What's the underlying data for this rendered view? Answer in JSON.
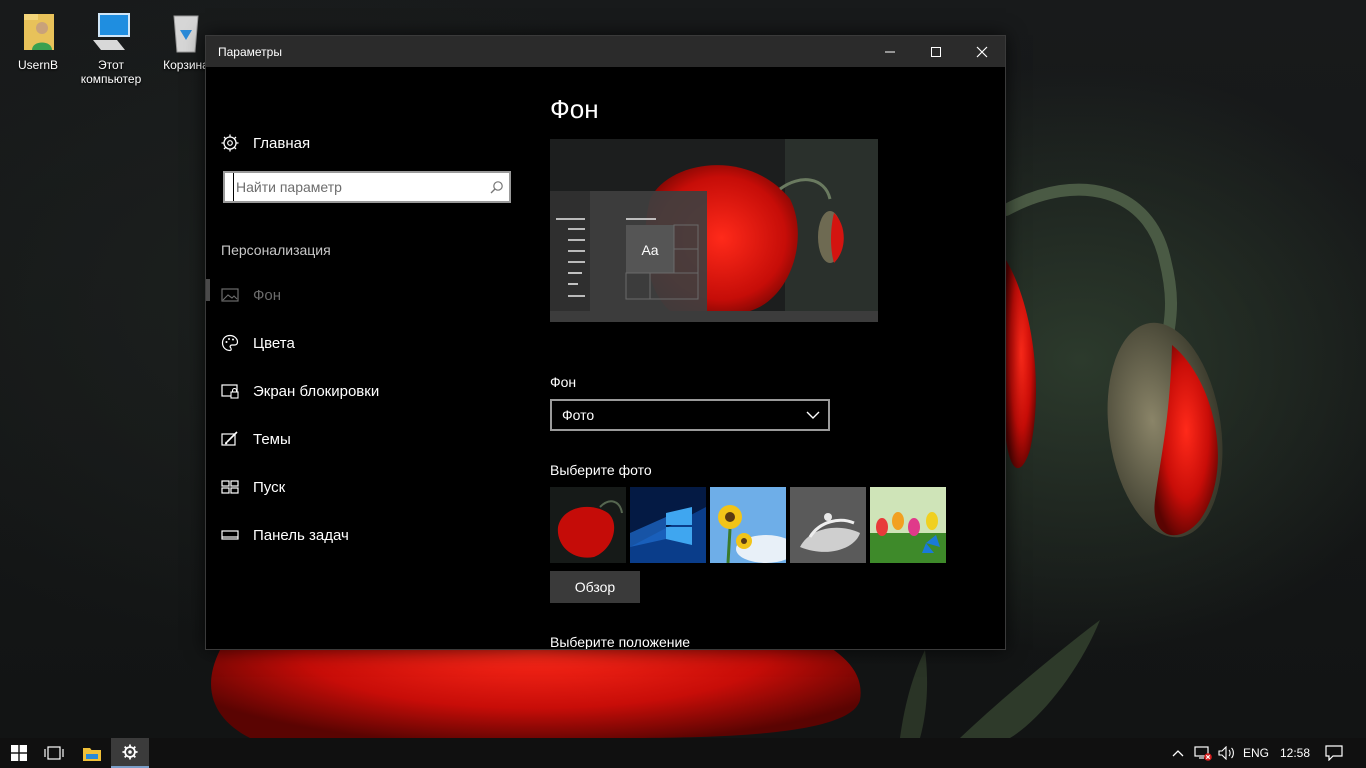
{
  "desktop": {
    "icons": [
      {
        "label": "UsernB"
      },
      {
        "label": "Этот компьютер"
      },
      {
        "label": "Корзина"
      }
    ]
  },
  "window": {
    "title": "Параметры",
    "controls": {
      "minimize": "minimize-icon",
      "maximize": "maximize-icon",
      "close": "close-icon"
    }
  },
  "nav": {
    "home_label": "Главная",
    "search_placeholder": "Найти параметр",
    "section_header": "Персонализация",
    "items": [
      {
        "label": "Фон",
        "icon": "picture-icon",
        "active": true
      },
      {
        "label": "Цвета",
        "icon": "palette-icon",
        "active": false
      },
      {
        "label": "Экран блокировки",
        "icon": "lock-screen-icon",
        "active": false
      },
      {
        "label": "Темы",
        "icon": "themes-icon",
        "active": false
      },
      {
        "label": "Пуск",
        "icon": "start-icon",
        "active": false
      },
      {
        "label": "Панель задач",
        "icon": "taskbar-icon",
        "active": false
      }
    ]
  },
  "content": {
    "title": "Фон",
    "preview_sample_text": "Aa",
    "background_label": "Фон",
    "background_selected": "Фото",
    "choose_photo_label": "Выберите фото",
    "browse_label": "Обзор",
    "choose_position_label": "Выберите положение",
    "thumbnails": [
      "poppy",
      "windows-logo",
      "sunflower",
      "white-flower",
      "tulips-butterfly"
    ]
  },
  "taskbar": {
    "language": "ENG",
    "time": "12:58"
  },
  "colors": {
    "window_bg": "#000000",
    "titlebar": "#2b2b2b",
    "accent_red": "#c4100c",
    "taskbar": "#101010"
  }
}
